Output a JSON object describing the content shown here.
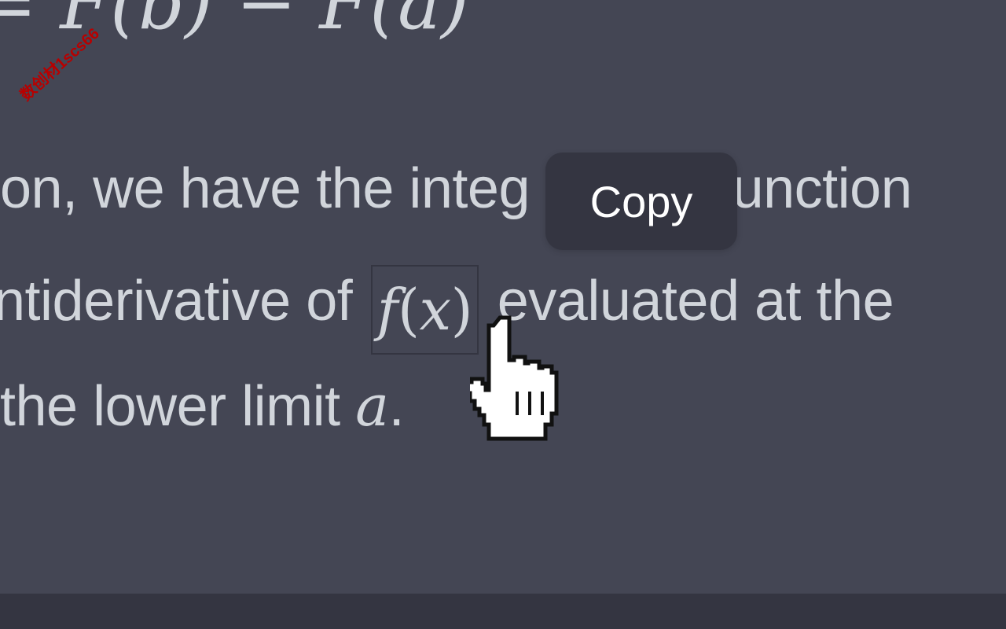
{
  "message": {
    "formula_partial": "= F(b) − F(a)",
    "line1": "on, we have the integ",
    "line1_after_tooltip": "a function",
    "line2_before": "ntiderivative of",
    "line2_math_f": "f",
    "line2_math_lparen": "(",
    "line2_math_x": "x",
    "line2_math_rparen": ")",
    "line2_after": "evaluated at the",
    "line3_before": "the lower limit",
    "line3_math": "a",
    "line3_after": "."
  },
  "tooltip": {
    "label": "Copy"
  },
  "watermark": {
    "text": "数创材1scs66"
  },
  "colors": {
    "background": "#444654",
    "text": "#d1d5db",
    "tooltip_bg": "#343541",
    "tooltip_text": "#ffffff",
    "footer_bg": "#343541",
    "watermark": "#b80000"
  },
  "cursor": {
    "icon": "pointer-hand-icon"
  }
}
